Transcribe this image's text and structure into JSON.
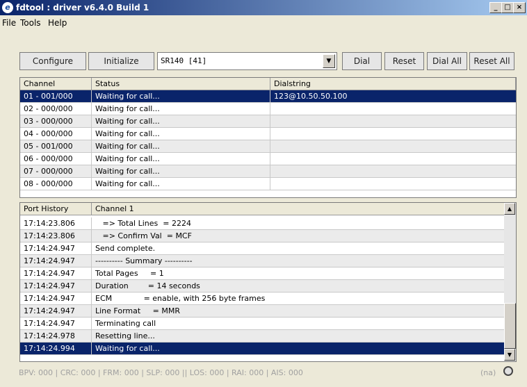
{
  "window": {
    "title": "fdtool : driver v6.4.0 Build 1"
  },
  "menu": {
    "file": "File",
    "tools": "Tools",
    "help": "Help"
  },
  "toolbar": {
    "configure": "Configure",
    "initialize": "Initialize",
    "target": "SR140 [41]",
    "dial": "Dial",
    "reset": "Reset",
    "dial_all": "Dial All",
    "reset_all": "Reset All"
  },
  "channels": {
    "headers": [
      "Channel",
      "Status",
      "Dialstring"
    ],
    "rows": [
      [
        "01 - 001/000",
        "Waiting for call...",
        "123@10.50.50.100"
      ],
      [
        "02 - 000/000",
        "Waiting for call...",
        ""
      ],
      [
        "03 - 000/000",
        "Waiting for call...",
        ""
      ],
      [
        "04 - 000/000",
        "Waiting for call...",
        ""
      ],
      [
        "05 - 001/000",
        "Waiting for call...",
        ""
      ],
      [
        "06 - 000/000",
        "Waiting for call...",
        ""
      ],
      [
        "07 - 000/000",
        "Waiting for call...",
        ""
      ],
      [
        "08 - 000/000",
        "Waiting for call...",
        ""
      ]
    ]
  },
  "history": {
    "headers": [
      "Port History",
      "Channel 1"
    ],
    "rows": [
      [
        "17:14:23.806",
        "   => Total Lines  = 2224"
      ],
      [
        "17:14:23.806",
        "   => Confirm Val  = MCF"
      ],
      [
        "17:14:24.947",
        "Send complete."
      ],
      [
        "17:14:24.947",
        "---------- Summary ----------"
      ],
      [
        "17:14:24.947",
        "Total Pages     = 1"
      ],
      [
        "17:14:24.947",
        "Duration        = 14 seconds"
      ],
      [
        "17:14:24.947",
        "ECM             = enable, with 256 byte frames"
      ],
      [
        "17:14:24.947",
        "Line Format     = MMR"
      ],
      [
        "17:14:24.947",
        "Terminating call"
      ],
      [
        "17:14:24.978",
        "Resetting line..."
      ],
      [
        "17:14:24.994",
        "Waiting for call..."
      ]
    ]
  },
  "statusbar": {
    "text": "BPV: 000 | CRC: 000 | FRM: 000 | SLP: 000 || LOS: 000 | RAI: 000 | AIS: 000",
    "na": "(na)"
  }
}
